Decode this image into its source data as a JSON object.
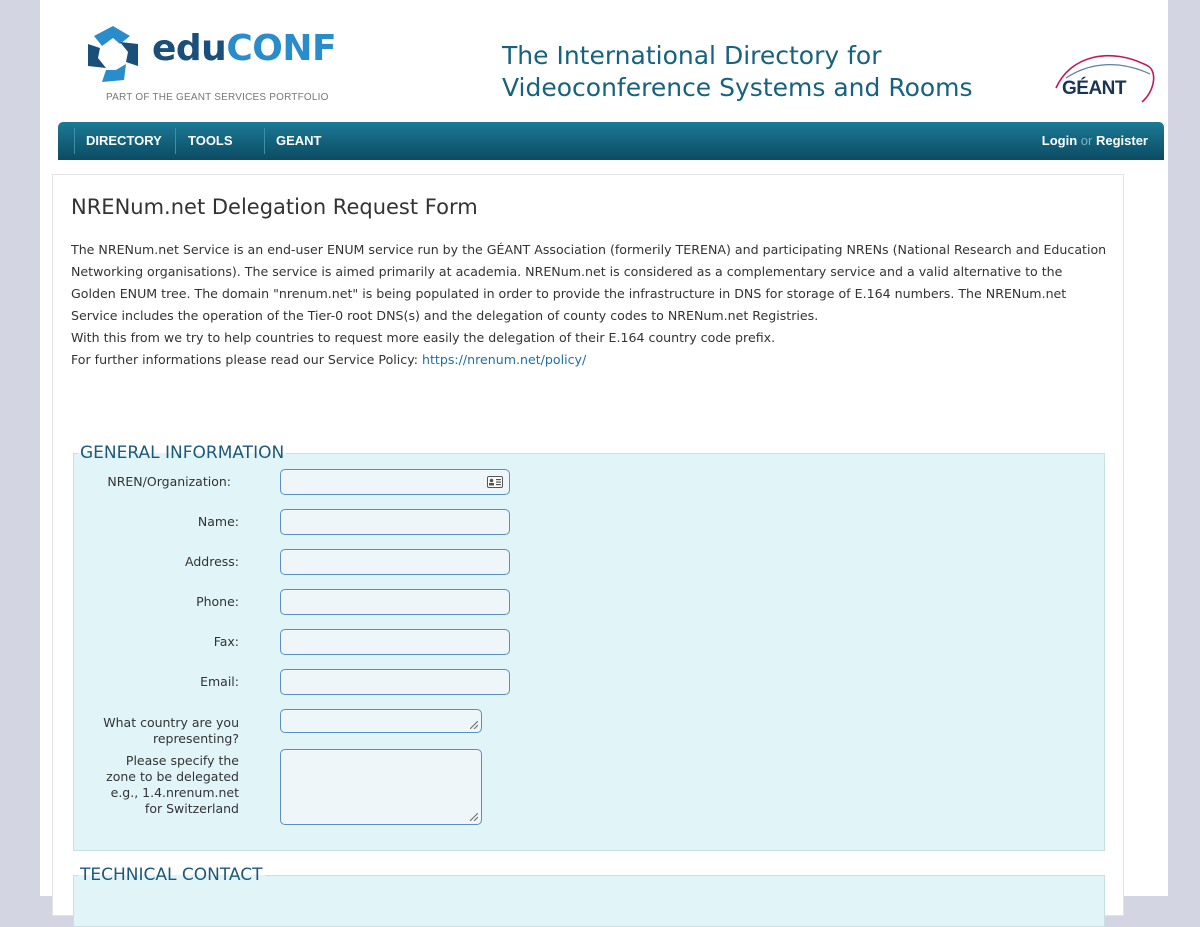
{
  "header": {
    "logo": {
      "word_part1": "edu",
      "word_part2": "CONF",
      "tagline": "PART OF THE GEANT SERVICES PORTFOLIO"
    },
    "site_title_line1": "The International Directory for",
    "site_title_line2": "Videoconference Systems and Rooms",
    "partner_logo_text": "GÉANT"
  },
  "nav": {
    "items": [
      {
        "label": "DIRECTORY"
      },
      {
        "label": "TOOLS"
      },
      {
        "label": "GEANT"
      }
    ],
    "login_label": "Login",
    "or_label": "or",
    "register_label": "Register"
  },
  "page": {
    "title": "NRENum.net Delegation Request Form",
    "intro_paragraph": "The NRENum.net Service is an end-user ENUM service run by the GÉANT Association (formerily TERENA) and participating NRENs (National Research and Education Networking organisations). The service is aimed primarily at academia. NRENum.net is considered as a complementary service and a valid alternative to the Golden ENUM tree. The domain \"nrenum.net\" is being populated in order to provide the infrastructure in DNS for storage of E.164 numbers. The NRENum.net Service includes the operation of the Tier-0 root DNS(s) and the delegation of county codes to NRENum.net Registries.",
    "intro_line2": "With this from we try to help countries to request more easily the delegation of their E.164 country code prefix.",
    "intro_line3_prefix": "For further informations please read our Service Policy: ",
    "policy_link": "https://nrenum.net/policy/"
  },
  "general_info": {
    "legend": "GENERAL INFORMATION",
    "fields": {
      "org": {
        "label": "NREN/Organization:",
        "value": ""
      },
      "name": {
        "label": "Name:",
        "value": ""
      },
      "address": {
        "label": "Address:",
        "value": ""
      },
      "phone": {
        "label": "Phone:",
        "value": ""
      },
      "fax": {
        "label": "Fax:",
        "value": ""
      },
      "email": {
        "label": "Email:",
        "value": ""
      },
      "country": {
        "label": "What country are you representing?",
        "value": ""
      },
      "zone": {
        "label": "Please specify the zone to be delegated e.g., 1.4.nrenum.net for Switzerland",
        "value": ""
      }
    }
  },
  "technical_contact": {
    "legend": "TECHNICAL CONTACT"
  },
  "icons": {
    "contact_card": "contact-card-icon",
    "resize": "resize-handle-icon"
  },
  "colors": {
    "accent": "#17627e",
    "nav_top": "#1c7a96",
    "nav_bottom": "#0b4b62",
    "fieldset_bg": "#e1f4f8",
    "input_border": "#5a8fc4"
  }
}
